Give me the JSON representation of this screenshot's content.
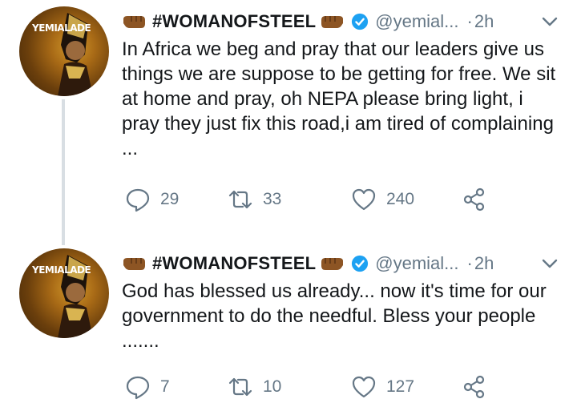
{
  "tweets": [
    {
      "avatar_text": "YEMIALADE",
      "author_name": "#WOMANOFSTEEL",
      "handle": "@yemial...",
      "separator": "·",
      "time": "2h",
      "text": "In Africa we beg and pray that our leaders give us things we are suppose to be getting for free. We sit at home and pray, oh NEPA please bring light, i pray they just fix this road,i am tired of complaining ...",
      "replies": "29",
      "retweets": "33",
      "likes": "240"
    },
    {
      "avatar_text": "YEMIALADE",
      "author_name": "#WOMANOFSTEEL",
      "handle": "@yemial...",
      "separator": "·",
      "time": "2h",
      "text": "God has blessed us already... now it's time for our government to do the needful. Bless your people .......",
      "replies": "7",
      "retweets": "10",
      "likes": "127"
    }
  ],
  "colors": {
    "text": "#14171a",
    "secondary": "#657786",
    "verified": "#1da1f2",
    "thread_line": "#d8dee3",
    "emoji_fist": "#8d5524"
  },
  "icons": [
    "fist-emoji-icon",
    "verified-badge-icon",
    "chevron-down-icon",
    "reply-icon",
    "retweet-icon",
    "like-icon",
    "share-icon"
  ]
}
